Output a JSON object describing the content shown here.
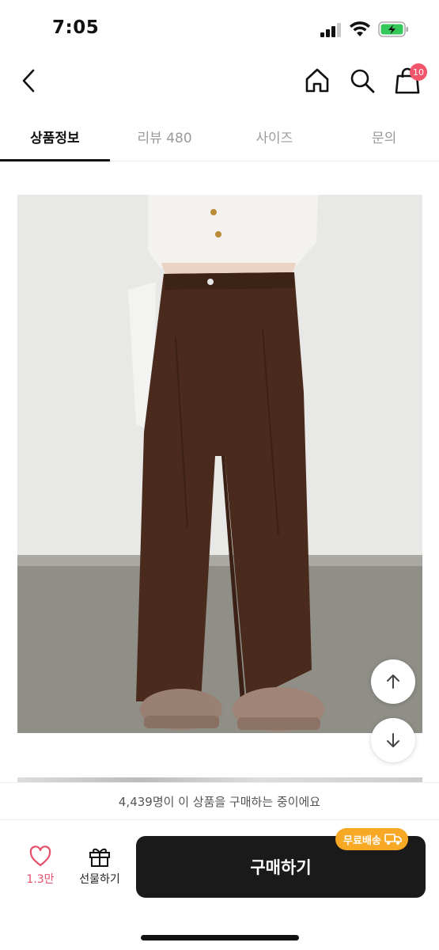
{
  "status": {
    "time": "7:05"
  },
  "header": {
    "cart_count": "10"
  },
  "tabs": [
    {
      "label": "상품정보",
      "active": true
    },
    {
      "label": "리뷰 480",
      "active": false
    },
    {
      "label": "사이즈",
      "active": false
    },
    {
      "label": "문의",
      "active": false
    }
  ],
  "bottom": {
    "buyers_text": "4,439명이 이 상품을 구매하는 중이에요",
    "like_count": "1.3만",
    "gift_label": "선물하기",
    "buy_label": "구매하기",
    "free_shipping": "무료배송"
  },
  "colors": {
    "accent_pink": "#f2566b",
    "buy_bg": "#1a1a1a",
    "free_ship_bg": "#f7a824"
  }
}
